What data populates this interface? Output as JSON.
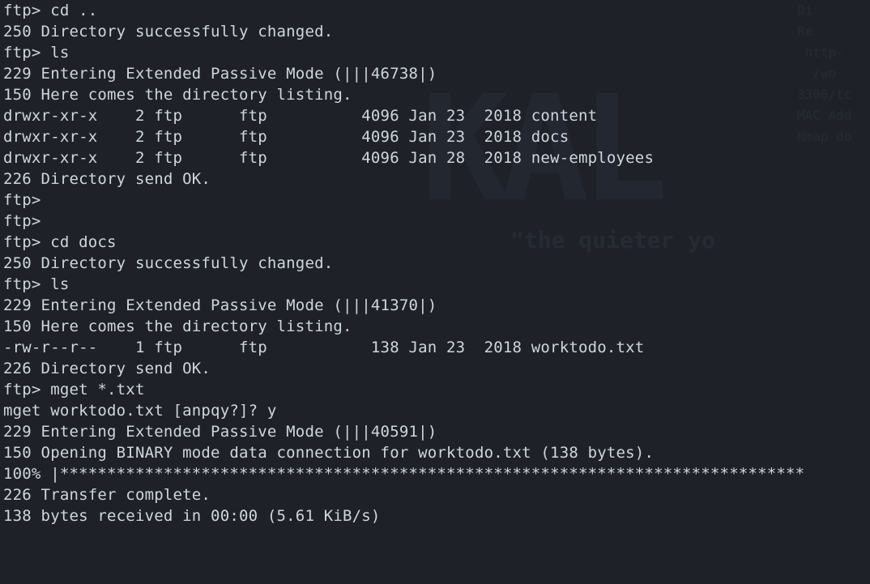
{
  "background": {
    "logo_text": "KAL",
    "tagline": "\"the quieter yo",
    "side_lines": [
      "Di",
      "Re",
      "",
      "",
      " http-",
      "  /wo",
      "3306/tc",
      "MAC Add",
      "",
      "Nmap do"
    ]
  },
  "terminal": {
    "lines": [
      "ftp> cd ..",
      "250 Directory successfully changed.",
      "ftp> ls",
      "229 Entering Extended Passive Mode (|||46738|)",
      "150 Here comes the directory listing.",
      "drwxr-xr-x    2 ftp      ftp          4096 Jan 23  2018 content",
      "drwxr-xr-x    2 ftp      ftp          4096 Jan 23  2018 docs",
      "drwxr-xr-x    2 ftp      ftp          4096 Jan 28  2018 new-employees",
      "226 Directory send OK.",
      "ftp> ",
      "ftp> ",
      "ftp> cd docs",
      "250 Directory successfully changed.",
      "ftp> ls",
      "229 Entering Extended Passive Mode (|||41370|)",
      "150 Here comes the directory listing.",
      "-rw-r--r--    1 ftp      ftp           138 Jan 23  2018 worktodo.txt",
      "226 Directory send OK.",
      "ftp> mget *.txt",
      "mget worktodo.txt [anpqy?]? y",
      "229 Entering Extended Passive Mode (|||40591|)",
      "150 Opening BINARY mode data connection for worktodo.txt (138 bytes).",
      "100% |*******************************************************************************",
      "226 Transfer complete.",
      "138 bytes received in 00:00 (5.61 KiB/s)"
    ]
  }
}
